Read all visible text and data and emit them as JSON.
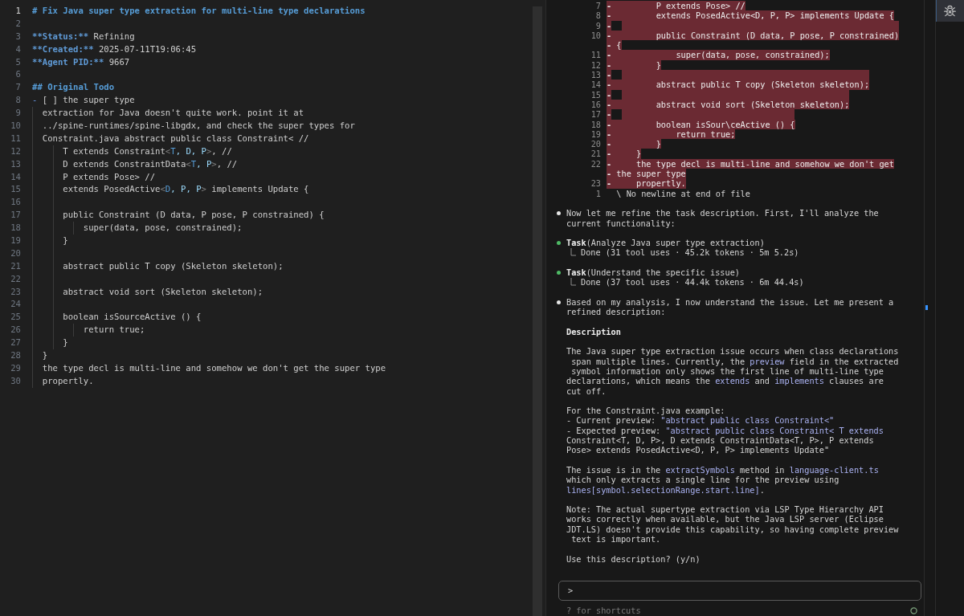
{
  "editor": {
    "lines": [
      {
        "number": "1",
        "current": true,
        "parts": [
          {
            "kind": "heading",
            "text": "# Fix Java super type extraction for multi-line type declarations"
          }
        ]
      },
      {
        "number": "2",
        "current": false
      },
      {
        "number": "3",
        "current": false,
        "parts": [
          {
            "kind": "bold",
            "text": "**Status:**"
          },
          {
            "kind": "plain",
            "text": " Refining"
          }
        ]
      },
      {
        "number": "4",
        "current": false,
        "parts": [
          {
            "kind": "bold",
            "text": "**Created:**"
          },
          {
            "kind": "plain",
            "text": " 2025-07-11T19:06:45"
          }
        ]
      },
      {
        "number": "5",
        "current": false,
        "parts": [
          {
            "kind": "bold",
            "text": "**Agent PID:**"
          },
          {
            "kind": "plain",
            "text": " 9667"
          }
        ]
      },
      {
        "number": "6",
        "current": false
      },
      {
        "number": "7",
        "current": false,
        "parts": [
          {
            "kind": "heading",
            "text": "## Original Todo"
          }
        ]
      },
      {
        "number": "8",
        "current": false,
        "parts": [
          {
            "kind": "marker",
            "text": "-"
          },
          {
            "kind": "plain",
            "text": " [ ] the super type"
          }
        ]
      },
      {
        "number": "9",
        "current": false,
        "parts": [
          {
            "kind": "plain",
            "text": "  extraction for Java doesn't quite work. point it at"
          }
        ]
      },
      {
        "number": "10",
        "current": false,
        "parts": [
          {
            "kind": "plain",
            "text": "  ../spine-runtimes/spine-libgdx, and check the super types for"
          }
        ]
      },
      {
        "number": "11",
        "current": false,
        "parts": [
          {
            "kind": "plain",
            "text": "  Constraint.java abstract public class Constraint< //"
          }
        ]
      },
      {
        "number": "12",
        "current": false,
        "parts": [
          {
            "kind": "plain",
            "text": "      T extends Constraint"
          },
          {
            "kind": "bracket",
            "text": "<"
          },
          {
            "kind": "tag",
            "text": "T"
          },
          {
            "kind": "attr",
            "text": ", D, P"
          },
          {
            "kind": "bracket",
            "text": ">"
          },
          {
            "kind": "plain",
            "text": ", //"
          }
        ]
      },
      {
        "number": "13",
        "current": false,
        "parts": [
          {
            "kind": "plain",
            "text": "      D extends ConstraintData"
          },
          {
            "kind": "bracket",
            "text": "<"
          },
          {
            "kind": "tag",
            "text": "T"
          },
          {
            "kind": "attr",
            "text": ", P"
          },
          {
            "kind": "bracket",
            "text": ">"
          },
          {
            "kind": "plain",
            "text": ", //"
          }
        ]
      },
      {
        "number": "14",
        "current": false,
        "parts": [
          {
            "kind": "plain",
            "text": "      P extends Pose> //"
          }
        ]
      },
      {
        "number": "15",
        "current": false,
        "parts": [
          {
            "kind": "plain",
            "text": "      extends PosedActive"
          },
          {
            "kind": "bracket",
            "text": "<"
          },
          {
            "kind": "tag",
            "text": "D"
          },
          {
            "kind": "attr",
            "text": ", P, P"
          },
          {
            "kind": "bracket",
            "text": ">"
          },
          {
            "kind": "plain",
            "text": " implements Update {"
          }
        ]
      },
      {
        "number": "16",
        "current": false
      },
      {
        "number": "17",
        "current": false,
        "parts": [
          {
            "kind": "plain",
            "text": "      public Constraint (D data, P pose, P constrained) {"
          }
        ]
      },
      {
        "number": "18",
        "current": false,
        "parts": [
          {
            "kind": "plain",
            "text": "          super(data, pose, constrained);"
          }
        ]
      },
      {
        "number": "19",
        "current": false,
        "parts": [
          {
            "kind": "plain",
            "text": "      }"
          }
        ]
      },
      {
        "number": "20",
        "current": false
      },
      {
        "number": "21",
        "current": false,
        "parts": [
          {
            "kind": "plain",
            "text": "      abstract public T copy (Skeleton skeleton);"
          }
        ]
      },
      {
        "number": "22",
        "current": false
      },
      {
        "number": "23",
        "current": false,
        "parts": [
          {
            "kind": "plain",
            "text": "      abstract void sort (Skeleton skeleton);"
          }
        ]
      },
      {
        "number": "24",
        "current": false
      },
      {
        "number": "25",
        "current": false,
        "parts": [
          {
            "kind": "plain",
            "text": "      boolean isSourceActive () {"
          }
        ]
      },
      {
        "number": "26",
        "current": false,
        "parts": [
          {
            "kind": "plain",
            "text": "          return true;"
          }
        ]
      },
      {
        "number": "27",
        "current": false,
        "parts": [
          {
            "kind": "plain",
            "text": "      }"
          }
        ]
      },
      {
        "number": "28",
        "current": false,
        "parts": [
          {
            "kind": "plain",
            "text": "  }"
          }
        ]
      },
      {
        "number": "29",
        "current": false,
        "parts": [
          {
            "kind": "plain",
            "text": "  the type decl is multi-line and somehow we don't get the super type"
          }
        ]
      },
      {
        "number": "30",
        "current": false,
        "parts": [
          {
            "kind": "plain",
            "text": "  propertly."
          }
        ]
      }
    ]
  },
  "diff": {
    "rows": [
      {
        "kind": "removed",
        "number": "7",
        "marker": "-",
        "text": "        P extends Pose> //"
      },
      {
        "kind": "removed",
        "number": "8",
        "marker": "-",
        "text": "        extends PosedActive<D, P, P> implements Update {"
      },
      {
        "kind": "removed",
        "number": "9",
        "marker": "-"
      },
      {
        "kind": "removed",
        "number": "10",
        "marker": "-",
        "text": "        public Constraint (D data, P pose, P constrained)"
      },
      {
        "kind": "removed",
        "marker": "-",
        "text": "{"
      },
      {
        "kind": "removed",
        "number": "11",
        "marker": "-",
        "text": "            super(data, pose, constrained);"
      },
      {
        "kind": "removed",
        "number": "12",
        "marker": "-",
        "text": "        }"
      },
      {
        "kind": "removed",
        "number": "13",
        "marker": "-"
      },
      {
        "kind": "removed",
        "number": "14",
        "marker": "-",
        "text": "        abstract public T copy (Skeleton skeleton);"
      },
      {
        "kind": "removed",
        "number": "15",
        "marker": "-"
      },
      {
        "kind": "removed",
        "number": "16",
        "marker": "-",
        "text": "        abstract void sort (Skeleton skeleton);"
      },
      {
        "kind": "removed",
        "number": "17",
        "marker": "-"
      },
      {
        "kind": "removed",
        "number": "18",
        "marker": "-",
        "text": "        boolean isSour\\ceActive () {"
      },
      {
        "kind": "removed",
        "number": "19",
        "marker": "-",
        "text": "            return true;"
      },
      {
        "kind": "removed",
        "number": "20",
        "marker": "-",
        "text": "        }"
      },
      {
        "kind": "removed",
        "number": "21",
        "marker": "-",
        "text": "    }"
      },
      {
        "kind": "removed",
        "number": "22",
        "marker": "-",
        "text": "    the type decl is multi-line and somehow we don't get"
      },
      {
        "kind": "removed",
        "marker": "-",
        "text": "the super type"
      },
      {
        "kind": "removed",
        "number": "23",
        "marker": "-",
        "text": "    propertly."
      },
      {
        "kind": "note",
        "number": "1",
        "text": "\\ No newline at end of file"
      }
    ]
  },
  "conversation": {
    "messages": [
      {
        "kind": "text",
        "color": "#e6e6e6",
        "text": "Now let me refine the task description. First, I'll analyze the\ncurrent functionality:"
      },
      {
        "kind": "task",
        "color": "#4eba65",
        "title": "**Task**(Analyze Java super type extraction)",
        "result": "Done (31 tool uses · 45.2k tokens · 5m 5.2s)"
      },
      {
        "kind": "task",
        "color": "#4eba65",
        "title": "**Task**(Understand the specific issue)",
        "result": "Done (37 tool uses · 44.4k tokens · 6m 44.4s)"
      },
      {
        "kind": "text",
        "color": "#e6e6e6",
        "text": "Based on my analysis, I now understand the issue. Let me present a\nrefined description:",
        "body": [
          {
            "kind": "heading",
            "text": "Description"
          },
          {
            "kind": "paragraph",
            "parts": [
              {
                "kind": "plain",
                "text": "The Java super type extraction issue occurs when class declarations\n span multiple lines. Currently, the "
              },
              {
                "kind": "code",
                "text": "preview"
              },
              {
                "kind": "plain",
                "text": " field in the extracted\n symbol information only shows the first line of multi-line type\ndeclarations, which means the "
              },
              {
                "kind": "code",
                "text": "extends"
              },
              {
                "kind": "plain",
                "text": " and "
              },
              {
                "kind": "code",
                "text": "implements"
              },
              {
                "kind": "plain",
                "text": " clauses are\ncut off."
              }
            ]
          },
          {
            "kind": "paragraph",
            "parts": [
              {
                "kind": "plain",
                "text": "For the Constraint.java example:\n- Current preview: "
              },
              {
                "kind": "code",
                "text": "\"abstract public class Constraint<\""
              },
              {
                "kind": "plain",
                "text": "\n- Expected preview: "
              },
              {
                "kind": "code",
                "text": "\"abstract public class Constraint< T extends"
              },
              {
                "kind": "plain",
                "text": "\nConstraint<T, D, P>, D extends ConstraintData<T, P>, P extends\nPose> extends PosedActive<D, P, P> implements Update\""
              }
            ]
          },
          {
            "kind": "paragraph",
            "parts": [
              {
                "kind": "plain",
                "text": "The issue is in the "
              },
              {
                "kind": "code",
                "text": "extractSymbols"
              },
              {
                "kind": "plain",
                "text": " method in "
              },
              {
                "kind": "code",
                "text": "language-client.ts"
              },
              {
                "kind": "plain",
                "text": "\nwhich only extracts a single line for the preview using\n"
              },
              {
                "kind": "code",
                "text": "lines[symbol.selectionRange.start.line]"
              },
              {
                "kind": "plain",
                "text": "."
              }
            ]
          },
          {
            "kind": "paragraph",
            "parts": [
              {
                "kind": "plain",
                "text": "Note: The actual supertype extraction via LSP Type Hierarchy API\nworks correctly when available, but the Java LSP server (Eclipse\nJDT.LS) doesn't provide this capability, so having complete preview\n text is important."
              }
            ]
          },
          {
            "kind": "paragraph",
            "parts": [
              {
                "kind": "plain",
                "text": "Use this description? (y/n)"
              }
            ]
          }
        ]
      }
    ]
  },
  "prompt": {
    "symbol": ">",
    "hint": "? for shortcuts"
  },
  "activity_bar": {
    "items": [
      {
        "selected": true
      }
    ]
  }
}
